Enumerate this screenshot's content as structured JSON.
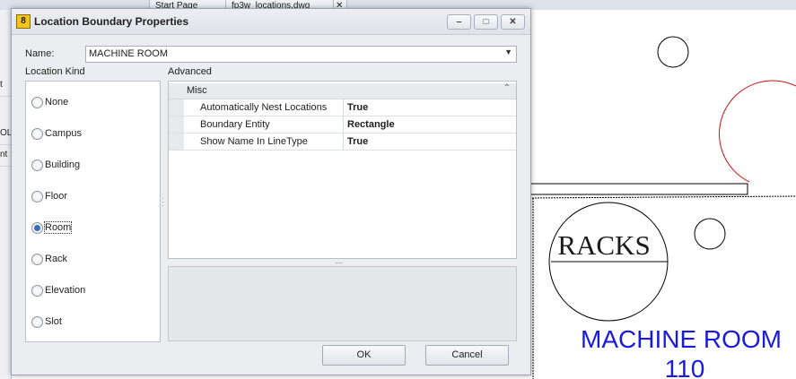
{
  "background": {
    "tabs": [
      {
        "label": "Start Page"
      },
      {
        "label": "fp3w_locations.dwg"
      }
    ],
    "left_fragments": [
      "t C",
      "OL",
      "nt"
    ],
    "drawing": {
      "racks_label": "RACKS",
      "room_name": "MACHINE ROOM",
      "room_number": "110",
      "room_text_color": "#1a1adf",
      "arc_color": "#d01010"
    }
  },
  "dialog": {
    "title": "Location Boundary Properties",
    "icon_glyph": "8",
    "controls": {
      "minimize": "‒",
      "maximize": "□",
      "close": "✕"
    },
    "name_label": "Name:",
    "name_value": "MACHINE ROOM",
    "location_kind_label": "Location Kind",
    "advanced_label": "Advanced",
    "location_kinds": [
      {
        "label": "None",
        "checked": false
      },
      {
        "label": "Campus",
        "checked": false
      },
      {
        "label": "Building",
        "checked": false
      },
      {
        "label": "Floor",
        "checked": false
      },
      {
        "label": "Room",
        "checked": true
      },
      {
        "label": "Rack",
        "checked": false
      },
      {
        "label": "Elevation",
        "checked": false
      },
      {
        "label": "Slot",
        "checked": false
      }
    ],
    "property_grid": {
      "category": "Misc",
      "rows": [
        {
          "name": "Automatically Nest Locations",
          "value": "True"
        },
        {
          "name": "Boundary Entity",
          "value": "Rectangle"
        },
        {
          "name": "Show Name In LineType",
          "value": "True"
        }
      ]
    },
    "ok_label": "OK",
    "cancel_label": "Cancel"
  }
}
